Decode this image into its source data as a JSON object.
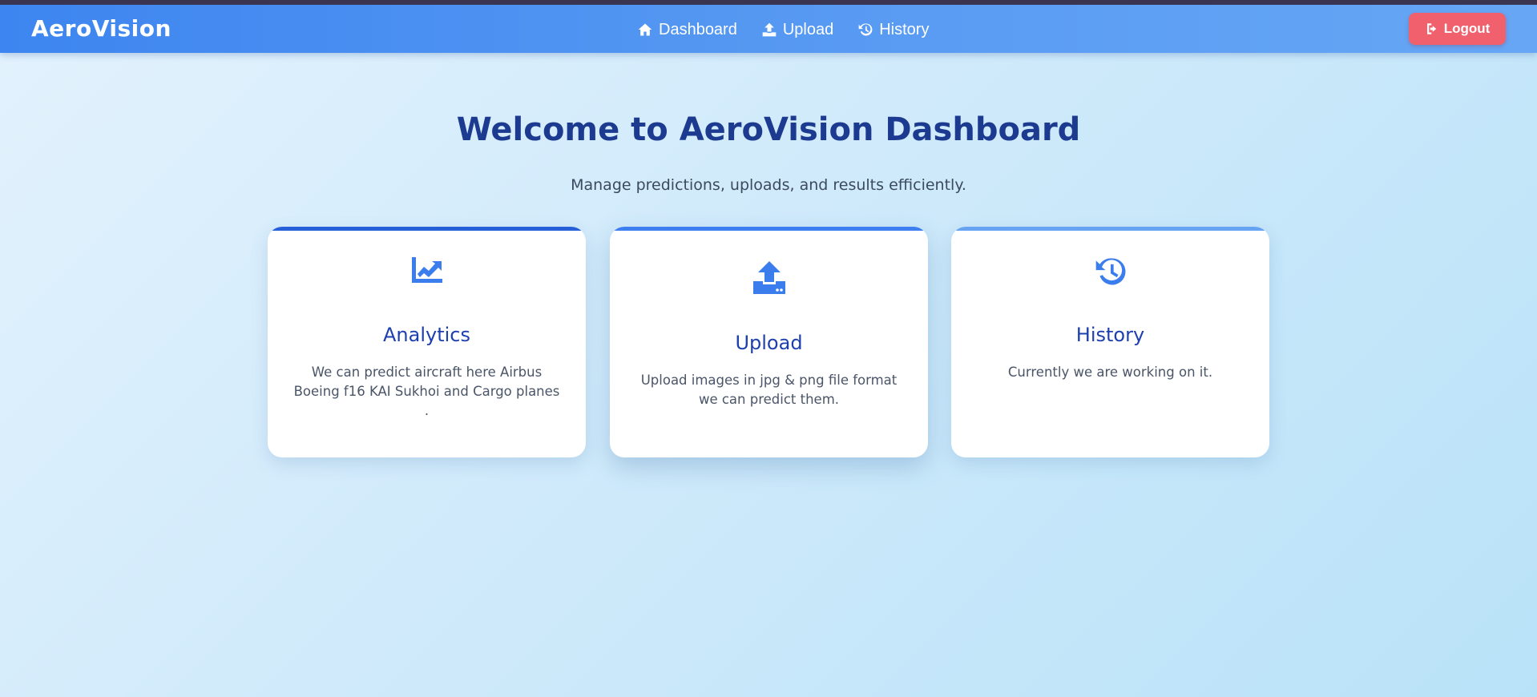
{
  "brand": "AeroVision",
  "nav": {
    "items": [
      {
        "label": "Dashboard",
        "icon": "home-icon"
      },
      {
        "label": "Upload",
        "icon": "upload-icon"
      },
      {
        "label": "History",
        "icon": "history-icon"
      }
    ],
    "logout_label": "Logout"
  },
  "main": {
    "title": "Welcome to AeroVision Dashboard",
    "subtitle": "Manage predictions, uploads, and results efficiently."
  },
  "cards": [
    {
      "title": "Analytics",
      "text": "We can predict aircraft here Airbus Boeing f16 KAI Sukhoi and Cargo planes .",
      "icon": "chart-line-icon"
    },
    {
      "title": "Upload",
      "text": "Upload images in jpg & png file format we can predict them.",
      "icon": "file-upload-icon"
    },
    {
      "title": "History",
      "text": "Currently we are working on it.",
      "icon": "history-icon"
    }
  ],
  "colors": {
    "navbar": "#3d85f0",
    "logout": "#f0616d",
    "title": "#1c3a8f",
    "card_title": "#1e40af",
    "icon": "#3b7ded"
  }
}
